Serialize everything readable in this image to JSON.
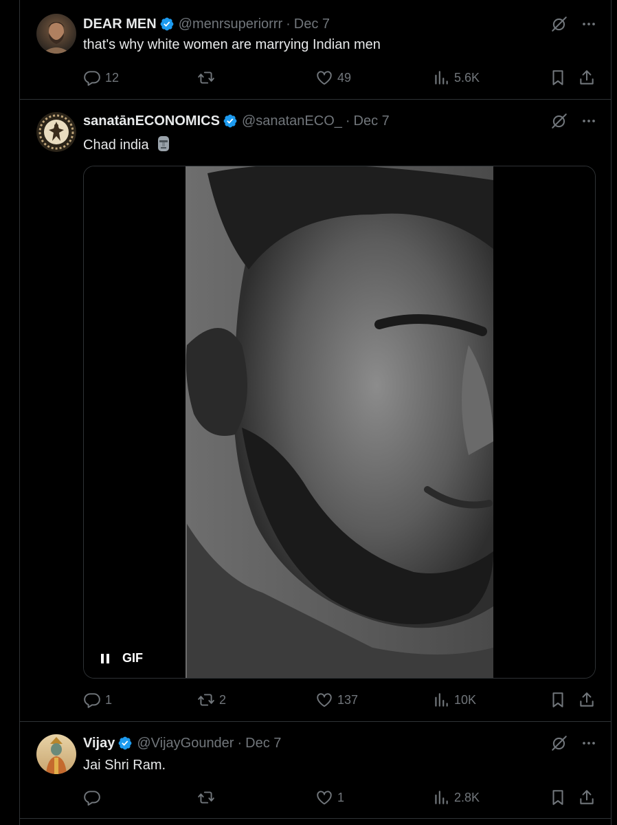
{
  "tweets": [
    {
      "display_name": "DEAR MEN",
      "handle": "@menrsuperiorrr",
      "separator": "·",
      "date": "Dec 7",
      "text": "that's why white women are marrying Indian men",
      "replies": "12",
      "reposts": "",
      "likes": "49",
      "views": "5.6K"
    },
    {
      "display_name": "sanatānECONOMICS",
      "handle": "@sanatanECO_",
      "separator": "·",
      "date": "Dec 7",
      "text": "Chad india",
      "emoji": "moai",
      "media_badge": "GIF",
      "replies": "1",
      "reposts": "2",
      "likes": "137",
      "views": "10K"
    },
    {
      "display_name": "Vijay",
      "handle": "@VijayGounder",
      "separator": "·",
      "date": "Dec 7",
      "text": "Jai Shri Ram.",
      "replies": "",
      "reposts": "",
      "likes": "1",
      "views": "2.8K"
    }
  ],
  "icons": {
    "verified": "verified-badge-icon",
    "grok": "grok-icon",
    "more": "more-icon",
    "reply": "reply-icon",
    "repost": "repost-icon",
    "like": "heart-icon",
    "views": "views-icon",
    "bookmark": "bookmark-icon",
    "share": "share-icon",
    "pause": "pause-icon"
  },
  "colors": {
    "background": "#000000",
    "text": "#e7e9ea",
    "muted": "#71767b",
    "verified": "#1d9bf0",
    "border": "#2f3336"
  }
}
